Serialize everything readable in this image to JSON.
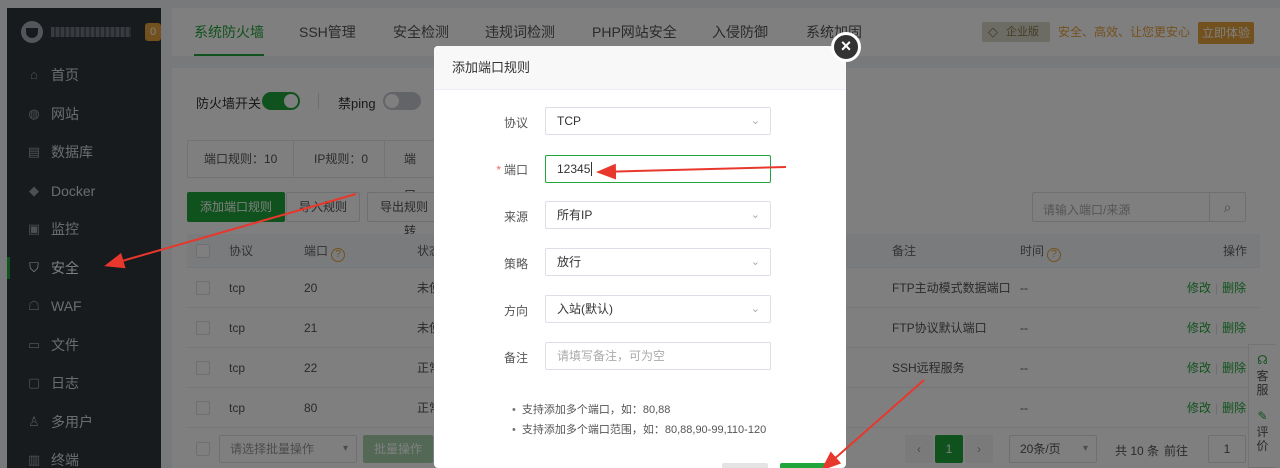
{
  "sidebar": {
    "badge": "0",
    "items": [
      {
        "label": "首页",
        "icon": "home-icon",
        "glyph": "⌂"
      },
      {
        "label": "网站",
        "icon": "globe-icon",
        "glyph": "◍"
      },
      {
        "label": "数据库",
        "icon": "database-icon",
        "glyph": "▤"
      },
      {
        "label": "Docker",
        "icon": "docker-icon",
        "glyph": "◆"
      },
      {
        "label": "监控",
        "icon": "monitor-icon",
        "glyph": "▣"
      },
      {
        "label": "安全",
        "icon": "shield-icon",
        "glyph": "⛉",
        "active": true
      },
      {
        "label": "WAF",
        "icon": "waf-icon",
        "glyph": "☖"
      },
      {
        "label": "文件",
        "icon": "folder-icon",
        "glyph": "▭"
      },
      {
        "label": "日志",
        "icon": "log-icon",
        "glyph": "▢"
      },
      {
        "label": "多用户",
        "icon": "users-icon",
        "glyph": "♙"
      },
      {
        "label": "终端",
        "icon": "terminal-icon",
        "glyph": "▥"
      }
    ]
  },
  "topbar": {
    "tabs": [
      "系统防火墙",
      "SSH管理",
      "安全检测",
      "违规词检测",
      "PHP网站安全",
      "入侵防御",
      "系统加固"
    ],
    "enterprise": "企业版",
    "slogan": "安全、高效、让您更安心",
    "try_label": "立即体验"
  },
  "firewall": {
    "switch_label": "防火墙开关",
    "ping_label": "禁ping",
    "rule_tabs": [
      "端口规则：10",
      "IP规则：0",
      "端口转"
    ],
    "add_btn": "添加端口规则",
    "import_btn": "导入规则",
    "export_btn": "导出规则",
    "search_placeholder": "请输入端口/来源"
  },
  "table": {
    "headers": {
      "proto": "协议",
      "port": "端口",
      "status": "状态",
      "remark": "备注",
      "time": "时间",
      "ops": "操作"
    },
    "rows": [
      {
        "proto": "tcp",
        "port": "20",
        "status": "未使用",
        "remark": "FTP主动模式数据端口",
        "time": "--"
      },
      {
        "proto": "tcp",
        "port": "21",
        "status": "未使用",
        "remark": "FTP协议默认端口",
        "time": "--"
      },
      {
        "proto": "tcp",
        "port": "22",
        "status": "正常",
        "remark": "SSH远程服务",
        "time": "--"
      },
      {
        "proto": "tcp",
        "port": "80",
        "status": "正常",
        "remark": "",
        "time": "--"
      }
    ],
    "edit": "修改",
    "delete": "删除"
  },
  "footer": {
    "bulk_select": "请选择批量操作",
    "bulk_btn": "批量操作",
    "current_page": "1",
    "per_page": "20条/页",
    "total": "共 10 条",
    "goto": "前往",
    "goto_value": "1"
  },
  "float_side": {
    "service": "客服",
    "review": "评价"
  },
  "modal": {
    "title": "添加端口规则",
    "protocol_label": "协议",
    "protocol_value": "TCP",
    "port_label": "端口",
    "port_value": "12345",
    "source_label": "来源",
    "source_value": "所有IP",
    "strategy_label": "策略",
    "strategy_value": "放行",
    "direction_label": "方向",
    "direction_value": "入站(默认)",
    "remark_label": "备注",
    "remark_placeholder": "请填写备注，可为空",
    "tips": [
      "支持添加多个端口，如：80,88",
      "支持添加多个端口范围，如：80,88,90-99,110-120"
    ]
  },
  "colors": {
    "accent": "#20a53a",
    "annotation": "#e8372c",
    "warning": "#e6a23c"
  }
}
